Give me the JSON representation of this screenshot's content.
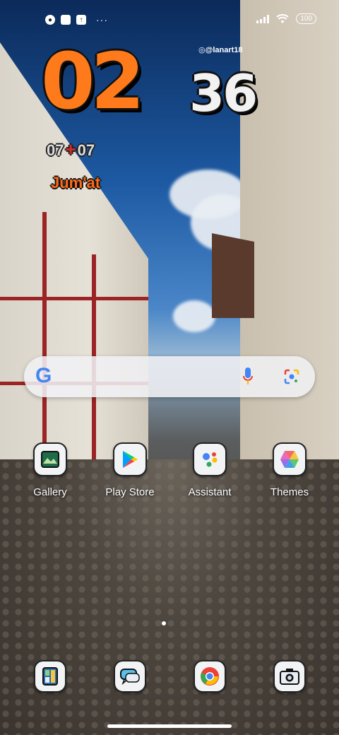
{
  "status_bar": {
    "left_icons": [
      "notification-app-icon",
      "notification-square-icon",
      "notification-upload-icon"
    ],
    "overflow": "···",
    "battery": "100"
  },
  "clock_widget": {
    "credit": "@lanart18",
    "hour": "02",
    "minute": "36",
    "date_left": "07",
    "date_sep": "+",
    "date_right": "07",
    "day": "Jum'at"
  },
  "search_bar": {
    "logo": "G",
    "icons": [
      "mic-icon",
      "lens-icon"
    ]
  },
  "apps": [
    {
      "label": "Gallery",
      "icon": "gallery-icon"
    },
    {
      "label": "Play Store",
      "icon": "play-store-icon"
    },
    {
      "label": "Assistant",
      "icon": "assistant-icon"
    },
    {
      "label": "Themes",
      "icon": "themes-icon"
    }
  ],
  "dock": [
    {
      "icon": "calculator-icon"
    },
    {
      "icon": "messages-icon"
    },
    {
      "icon": "chrome-icon"
    },
    {
      "icon": "camera-icon"
    }
  ],
  "pager": {
    "pages": 1,
    "current": 1
  },
  "colors": {
    "clock_hour": "#ff7a1a",
    "clock_minute": "#f2f2f2",
    "day": "#ff6a1a",
    "accent_red": "#d32b2b"
  }
}
